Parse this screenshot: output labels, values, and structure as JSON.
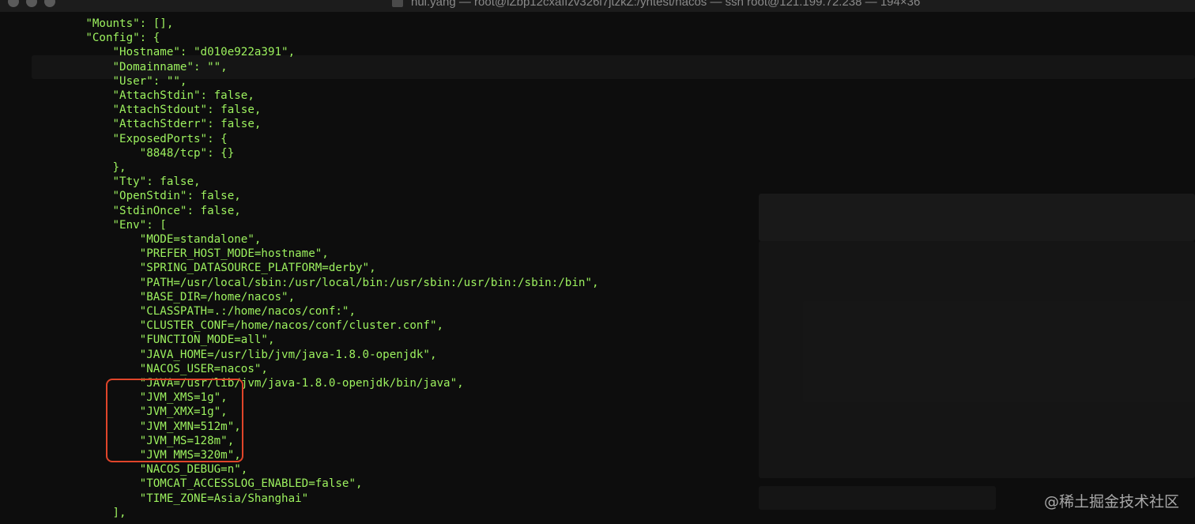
{
  "window": {
    "title": "hui.yang — root@iZbp12cxaffzv326i7jtzkZ:/yhtest/nacos — ssh root@121.199.72.238 — 194×36"
  },
  "terminal": {
    "lines": [
      "        \"Mounts\": [],",
      "        \"Config\": {",
      "            \"Hostname\": \"d010e922a391\",",
      "            \"Domainname\": \"\",",
      "            \"User\": \"\",",
      "            \"AttachStdin\": false,",
      "            \"AttachStdout\": false,",
      "            \"AttachStderr\": false,",
      "            \"ExposedPorts\": {",
      "                \"8848/tcp\": {}",
      "            },",
      "            \"Tty\": false,",
      "            \"OpenStdin\": false,",
      "            \"StdinOnce\": false,",
      "            \"Env\": [",
      "                \"MODE=standalone\",",
      "                \"PREFER_HOST_MODE=hostname\",",
      "                \"SPRING_DATASOURCE_PLATFORM=derby\",",
      "                \"PATH=/usr/local/sbin:/usr/local/bin:/usr/sbin:/usr/bin:/sbin:/bin\",",
      "                \"BASE_DIR=/home/nacos\",",
      "                \"CLASSPATH=.:/home/nacos/conf:\",",
      "                \"CLUSTER_CONF=/home/nacos/conf/cluster.conf\",",
      "                \"FUNCTION_MODE=all\",",
      "                \"JAVA_HOME=/usr/lib/jvm/java-1.8.0-openjdk\",",
      "                \"NACOS_USER=nacos\",",
      "                \"JAVA=/usr/lib/jvm/java-1.8.0-openjdk/bin/java\",",
      "                \"JVM_XMS=1g\",",
      "                \"JVM_XMX=1g\",",
      "                \"JVM_XMN=512m\",",
      "                \"JVM_MS=128m\",",
      "                \"JVM_MMS=320m\",",
      "                \"NACOS_DEBUG=n\",",
      "                \"TOMCAT_ACCESSLOG_ENABLED=false\",",
      "                \"TIME_ZONE=Asia/Shanghai\"",
      "            ],"
    ]
  },
  "watermark": "@稀土掘金技术社区",
  "colors": {
    "terminal_text": "#9df25f",
    "highlight_border": "#e0452a",
    "background": "#0d0d0d"
  }
}
